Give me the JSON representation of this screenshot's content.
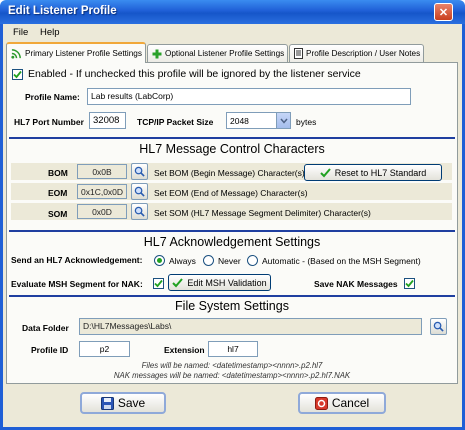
{
  "window": {
    "title": "Edit Listener Profile",
    "close_glyph": "✕"
  },
  "menu": {
    "items": [
      "File",
      "Help"
    ]
  },
  "tabs": [
    {
      "label": "Primary Listener Profile Settings",
      "icon": "wifi-icon"
    },
    {
      "label": "Optional Listener Profile Settings",
      "icon": "plus-icon"
    },
    {
      "label": "Profile Description / User Notes",
      "icon": "document-icon"
    }
  ],
  "general": {
    "enabled_label": "Enabled - If unchecked this profile will be ignored by the listener service",
    "enabled": true,
    "profile_name_label": "Profile Name:",
    "profile_name_value": "Lab results (LabCorp)",
    "port_label": "HL7 Port Number",
    "port_value": "32008",
    "packet_label": "TCP/IP Packet Size",
    "packet_value": "2048",
    "packet_unit": "bytes"
  },
  "control_chars": {
    "title": "HL7 Message Control Characters",
    "bom": {
      "label": "BOM",
      "value": "0x0B",
      "desc": "Set BOM (Begin Message) Character(s)"
    },
    "eom": {
      "label": "EOM",
      "value": "0x1C,0x0D",
      "desc": "Set EOM (End of Message) Character(s)"
    },
    "som": {
      "label": "SOM",
      "value": "0x0D",
      "desc": "Set SOM (HL7 Message Segment Delimiter) Character(s)"
    },
    "reset_label": "Reset to HL7 Standard"
  },
  "ack": {
    "title": "HL7 Acknowledgement Settings",
    "send_label": "Send an HL7 Acknowledgement:",
    "options": [
      "Always",
      "Never",
      "Automatic - (Based on the MSH Segment)"
    ],
    "selected": "Always",
    "eval_label": "Evaluate MSH Segment for NAK:",
    "eval_checked": true,
    "edit_msh_label": "Edit MSH Validation",
    "save_nak_label": "Save NAK Messages",
    "save_nak_checked": true
  },
  "filesystem": {
    "title": "File System Settings",
    "folder_label": "Data Folder",
    "folder_value": "D:\\HL7Messages\\Labs\\",
    "profile_id_label": "Profile ID",
    "profile_id_value": "p2",
    "extension_label": "Extension",
    "extension_value": "hl7",
    "files_note": "Files will be named: <datetimestamp><nnnn>.p2.hl7",
    "nak_note": "NAK messages will be named: <datetimestamp><nnnn>.p2.hl7.NAK"
  },
  "footer": {
    "save_label": "Save",
    "cancel_label": "Cancel"
  }
}
